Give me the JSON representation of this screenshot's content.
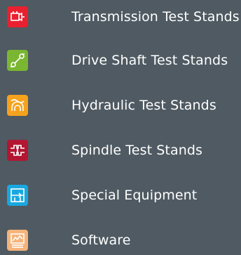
{
  "menu": {
    "items": [
      {
        "label": "Transmission Test Stands",
        "icon": "transmission-icon",
        "color": "#e8202f"
      },
      {
        "label": "Drive Shaft Test Stands",
        "icon": "drive-shaft-icon",
        "color": "#7ab632"
      },
      {
        "label": "Hydraulic Test Stands",
        "icon": "hydraulic-icon",
        "color": "#f5a21d"
      },
      {
        "label": "Spindle Test Stands",
        "icon": "spindle-icon",
        "color": "#b31631"
      },
      {
        "label": "Special Equipment",
        "icon": "special-equipment-icon",
        "color": "#1aa7df"
      },
      {
        "label": "Software",
        "icon": "software-icon",
        "color": "#f6b37a"
      }
    ]
  }
}
